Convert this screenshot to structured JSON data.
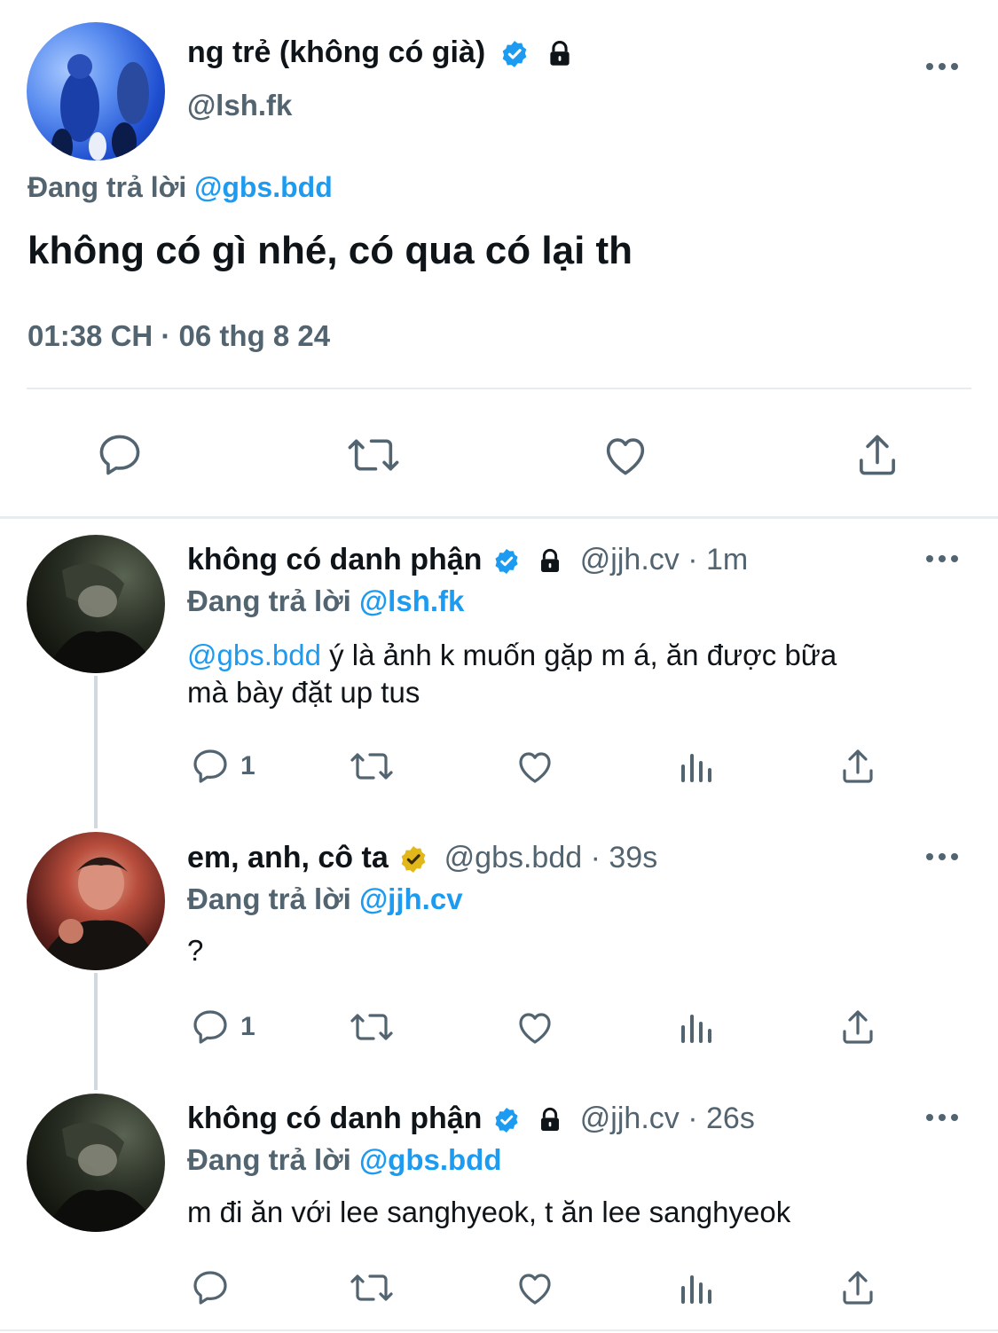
{
  "main_tweet": {
    "display_name": "ng trẻ (không có già)",
    "handle": "@lsh.fk",
    "reply_prefix": "Đang trả lời",
    "reply_to": "@gbs.bdd",
    "text": "không có gì nhé, có qua có lại th",
    "timestamp": "01:38 CH · 06 thg 8 24"
  },
  "replies": [
    {
      "display_name": "không có danh phận",
      "handle": "@jjh.cv",
      "time": "· 1m",
      "reply_prefix": "Đang trả lời",
      "reply_to": "@lsh.fk",
      "mention": "@gbs.bdd",
      "text_line1": " ý là ảnh k muốn gặp m á, ăn được bữa",
      "text_line2": "mà bày đặt up tus",
      "reply_count": "1"
    },
    {
      "display_name": "em, anh, cô ta",
      "handle": "@gbs.bdd",
      "time": "· 39s",
      "reply_prefix": "Đang trả lời",
      "reply_to": "@jjh.cv",
      "text": "?",
      "reply_count": "1"
    },
    {
      "display_name": "không có danh phận",
      "handle": "@jjh.cv",
      "time": "· 26s",
      "reply_prefix": "Đang trả lời",
      "reply_to": "@gbs.bdd",
      "text": "m đi ăn với lee sanghyeok, t ăn lee sanghyeok",
      "reply_count": ""
    }
  ],
  "icons": {
    "verified": "verified-badge-icon",
    "lock": "lock-icon",
    "more": "more-horizontal-icon",
    "reply": "reply-icon",
    "retweet": "retweet-icon",
    "like": "heart-icon",
    "views": "views-icon",
    "share": "share-icon"
  },
  "colors": {
    "accent": "#1d9bf0",
    "gold_badge": "#e2b719",
    "text_secondary": "#536471"
  }
}
